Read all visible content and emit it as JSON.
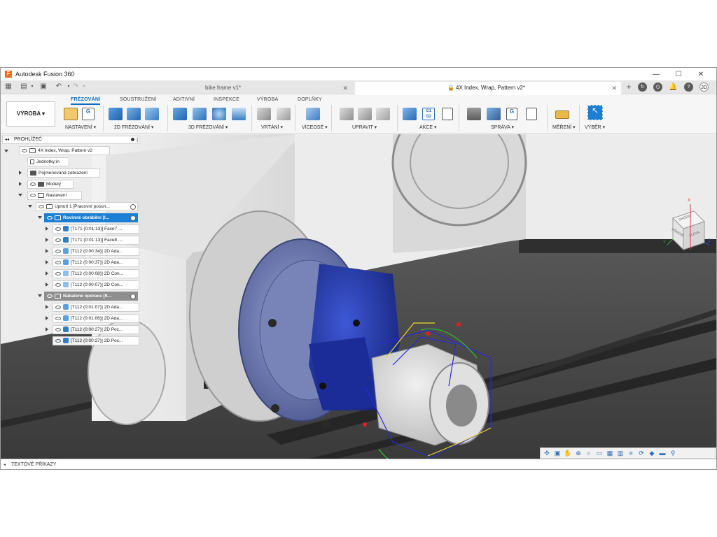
{
  "window": {
    "title": "Autodesk Fusion 360",
    "logo_letter": "F",
    "controls": [
      "—",
      "☐",
      "✕"
    ]
  },
  "tabs": [
    {
      "label": "bike frame v1*",
      "active": false
    },
    {
      "label": "4X Index, Wrap, Pattern v2*",
      "active": true
    }
  ],
  "user_initials": "JD",
  "ribbon": {
    "workspace": "VÝROBA ▾",
    "tabs": [
      "FRÉZOVÁNÍ",
      "SOUSTRUŽENÍ",
      "ADITIVNÍ",
      "INSPEKCE",
      "VÝROBA",
      "DOPLŇKY"
    ],
    "groups": [
      "NASTAVENÍ ▾",
      "2D FRÉZOVÁNÍ ▾",
      "3D FRÉZOVÁNÍ ▾",
      "VRTÁNÍ ▾",
      "VÍCEOSÉ ▾",
      "UPRAVIT ▾",
      "AKCE ▾",
      "SPRÁVA ▾",
      "MĚŘENÍ ▾",
      "VÝBĚR ▾"
    ]
  },
  "browser": {
    "header": "PROHLÍŽEČ",
    "root": "4X Index, Wrap, Pattern v2",
    "units": "Jednotky:in",
    "named_views": "Pojmenovaná zobrazení",
    "models": "Modely",
    "setups": "Nastavení",
    "setup1": "Upnutí 1 [Pracovní posun...",
    "group1": "Rovinné obrábění [I...",
    "ops1": [
      "[T171 (0:01:13)] Face7 ...",
      "[T171 (0:01:13)] Face8 ...",
      "[T112 (0:00:34)] 2D Ada...",
      "[T112 (0:00:37)] 2D Ada...",
      "[T112 (0:00:08)] 2D Con...",
      "[T112 (0:00:07)] 2D Con..."
    ],
    "group2": "Nabalené operace [K...",
    "ops2": [
      "[T112 (0:01:07)] 2D Ada...",
      "[T112 (0:01:06)] 2D Ada...",
      "[T112 (0:00:27)] 2D Poc...",
      "[T112 (0:00:27)] 2D Poc..."
    ]
  },
  "viewcube": {
    "front": "PŘEDNÍ",
    "left": "ZLEVA",
    "top": "SHORA",
    "axis_x": "X",
    "axis_y": "Y",
    "axis_z": "Z"
  },
  "bottom_bar": {
    "label": "TEXTOVÉ PŘÍKAZY"
  },
  "colors": {
    "accent": "#0f6bbf",
    "selection": "#1b7fd4",
    "fixture_blue": "#3548b8",
    "chuck": "#6e7fb0"
  }
}
